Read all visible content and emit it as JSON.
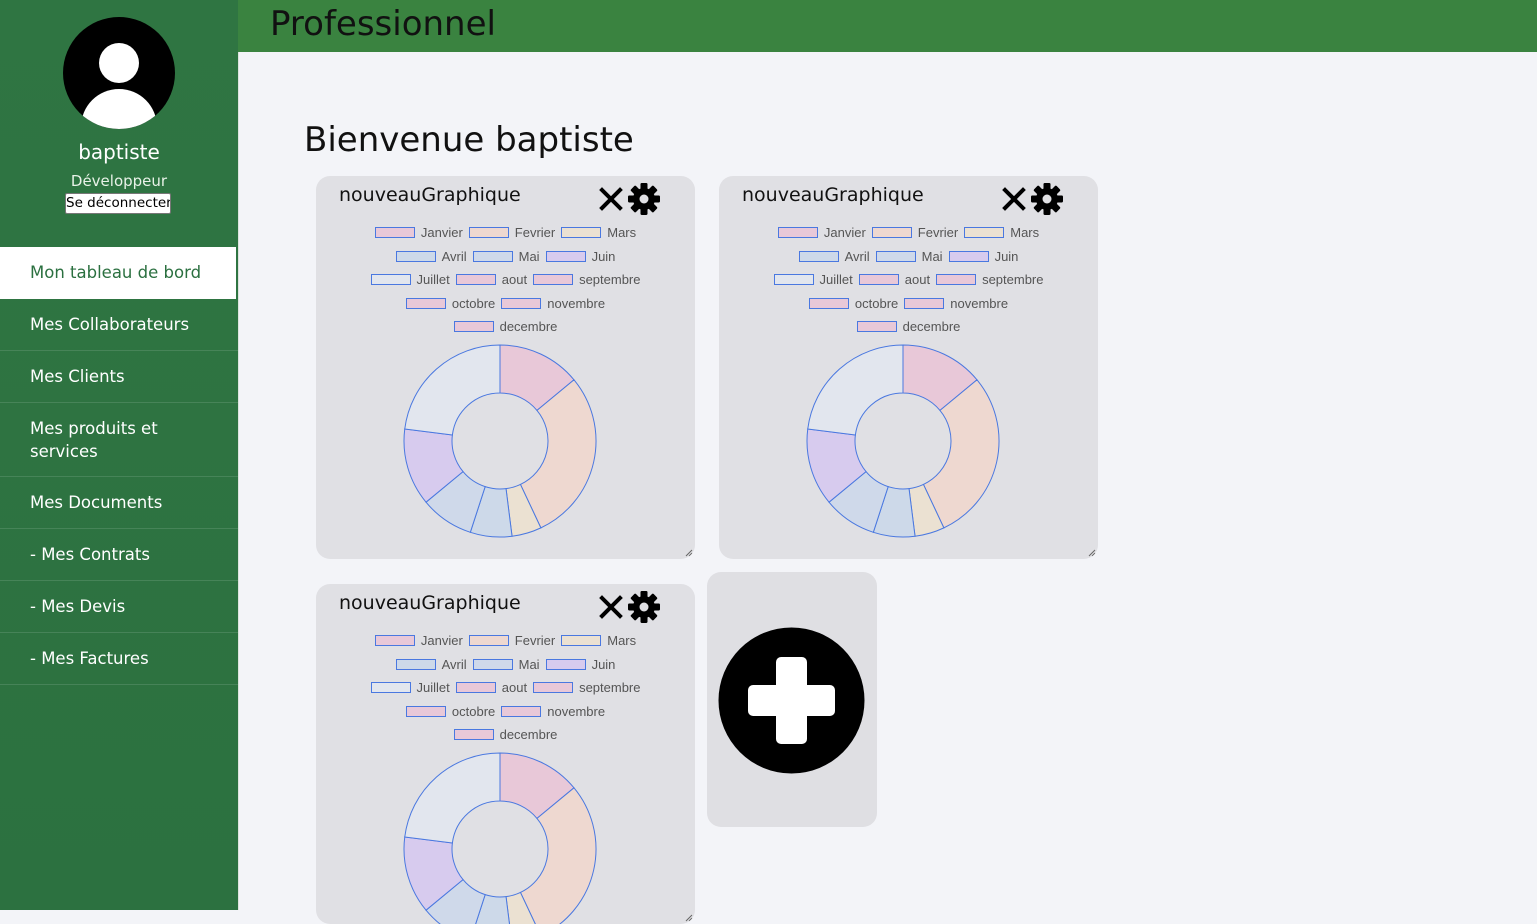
{
  "app": {
    "header_title": "Professionnel",
    "welcome": "Bienvenue baptiste"
  },
  "user": {
    "name": "baptiste",
    "role": "Développeur",
    "logout_label": "Se déconnecter",
    "avatar_icon": "user-avatar-icon"
  },
  "sidebar": {
    "items": [
      {
        "label": "Mon tableau de bord",
        "active": true
      },
      {
        "label": "Mes Collaborateurs"
      },
      {
        "label": "Mes Clients"
      },
      {
        "label": "Mes produits et services"
      },
      {
        "label": "Mes Documents"
      },
      {
        "label": "- Mes Contrats"
      },
      {
        "label": "- Mes Devis"
      },
      {
        "label": "- Mes Factures"
      }
    ]
  },
  "colors": {
    "sidebar_green": "#2e7441",
    "header_green": "#3a8340",
    "card_bg": "#e0e0e4",
    "slice_border": "#4a78e0"
  },
  "chart_data": [
    {
      "type": "pie",
      "title": "nouveauGraphique",
      "categories": [
        "Janvier",
        "Fevrier",
        "Mars",
        "Avril",
        "Mai",
        "Juin",
        "Juillet",
        "aout",
        "septembre",
        "octobre",
        "novembre",
        "decembre"
      ],
      "values": [
        14,
        29,
        5,
        7,
        9,
        13,
        23,
        0,
        0,
        0,
        0,
        0
      ],
      "slice_colors": [
        "#e8c8d8",
        "#eed8d0",
        "#ebe1d2",
        "#cdd9e9",
        "#cfd9ea",
        "#d7cbee",
        "#e2e6ee",
        "#e8c8d8",
        "#e8c8d8",
        "#e8c8d8",
        "#e8c8d8",
        "#e8c8d8"
      ],
      "legend_position": "top"
    },
    {
      "type": "pie",
      "title": "nouveauGraphique",
      "categories": [
        "Janvier",
        "Fevrier",
        "Mars",
        "Avril",
        "Mai",
        "Juin",
        "Juillet",
        "aout",
        "septembre",
        "octobre",
        "novembre",
        "decembre"
      ],
      "values": [
        14,
        29,
        5,
        7,
        9,
        13,
        23,
        0,
        0,
        0,
        0,
        0
      ],
      "slice_colors": [
        "#e8c8d8",
        "#eed8d0",
        "#ebe1d2",
        "#cdd9e9",
        "#cfd9ea",
        "#d7cbee",
        "#e2e6ee",
        "#e8c8d8",
        "#e8c8d8",
        "#e8c8d8",
        "#e8c8d8",
        "#e8c8d8"
      ],
      "legend_position": "top"
    },
    {
      "type": "pie",
      "title": "nouveauGraphique",
      "categories": [
        "Janvier",
        "Fevrier",
        "Mars",
        "Avril",
        "Mai",
        "Juin",
        "Juillet",
        "aout",
        "septembre",
        "octobre",
        "novembre",
        "decembre"
      ],
      "values": [
        14,
        29,
        5,
        7,
        9,
        13,
        23,
        0,
        0,
        0,
        0,
        0
      ],
      "slice_colors": [
        "#e8c8d8",
        "#eed8d0",
        "#ebe1d2",
        "#cdd9e9",
        "#cfd9ea",
        "#d7cbee",
        "#e2e6ee",
        "#e8c8d8",
        "#e8c8d8",
        "#e8c8d8",
        "#e8c8d8",
        "#e8c8d8"
      ],
      "legend_position": "top"
    }
  ],
  "cards": {
    "close_icon": "close-icon",
    "settings_icon": "gear-icon",
    "add_icon": "plus-circle-icon"
  }
}
